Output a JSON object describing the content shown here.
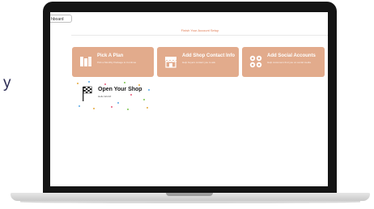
{
  "side_text": "y",
  "screen": {
    "dashboard_button_label": "hboard",
    "setup_title": "Finish Your Account Setup",
    "cards": [
      {
        "title": "Pick A Plan",
        "subtitle": "Pick a Monthly Package to Continue",
        "icon": "columns-icon"
      },
      {
        "title": "Add Shop Contact Info",
        "subtitle": "Help buyers contact you to ask",
        "icon": "storefront-icon"
      },
      {
        "title": "Add Social Accounts",
        "subtitle": "Help customers find you on social media",
        "icon": "social-icons"
      }
    ],
    "shop_card": {
      "title": "Open Your Shop",
      "subtitle": "Hello World!",
      "icon": "checkered-flag-icon"
    }
  },
  "colors": {
    "card_background": "#e2ab8c",
    "accent_text": "#e07a52",
    "laptop_frame": "#141414"
  }
}
